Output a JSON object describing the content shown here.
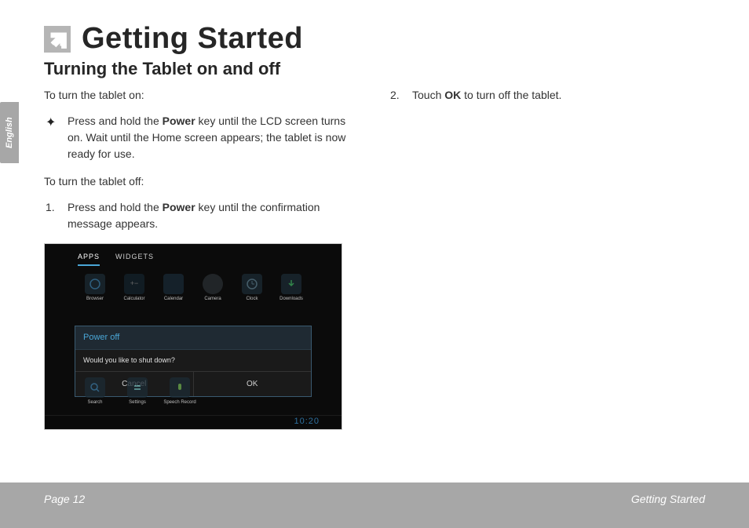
{
  "language_tab": "English",
  "header": {
    "title": "Getting Started",
    "subtitle": "Turning the Tablet on and off"
  },
  "left_column": {
    "para_on_label": "To turn the tablet on:",
    "bullet_on_pre": "Press and hold the ",
    "bullet_on_bold": "Power",
    "bullet_on_post": " key until the LCD screen turns on. Wait until the Home screen appears; the tablet is now ready for use.",
    "para_off_label": "To turn the tablet off:",
    "step1_num": "1.",
    "step1_pre": "Press and hold the ",
    "step1_bold": "Power",
    "step1_post": " key until the confirmation message appears."
  },
  "right_column": {
    "step2_num": "2.",
    "step2_pre": "Touch ",
    "step2_bold": "OK",
    "step2_post": " to turn off the tablet."
  },
  "screenshot": {
    "tab_apps": "APPS",
    "tab_widgets": "WIDGETS",
    "apps_row1": [
      "Browser",
      "Calculator",
      "Calendar",
      "Camera",
      "Clock",
      "Downloads"
    ],
    "apps_row2": [
      "Search",
      "Settings",
      "Speech Record"
    ],
    "dialog_title": "Power off",
    "dialog_msg": "Would you like to shut down?",
    "btn_cancel": "Cancel",
    "btn_ok": "OK",
    "time": "10:20"
  },
  "footer": {
    "left": "Page 12",
    "right": "Getting Started"
  }
}
